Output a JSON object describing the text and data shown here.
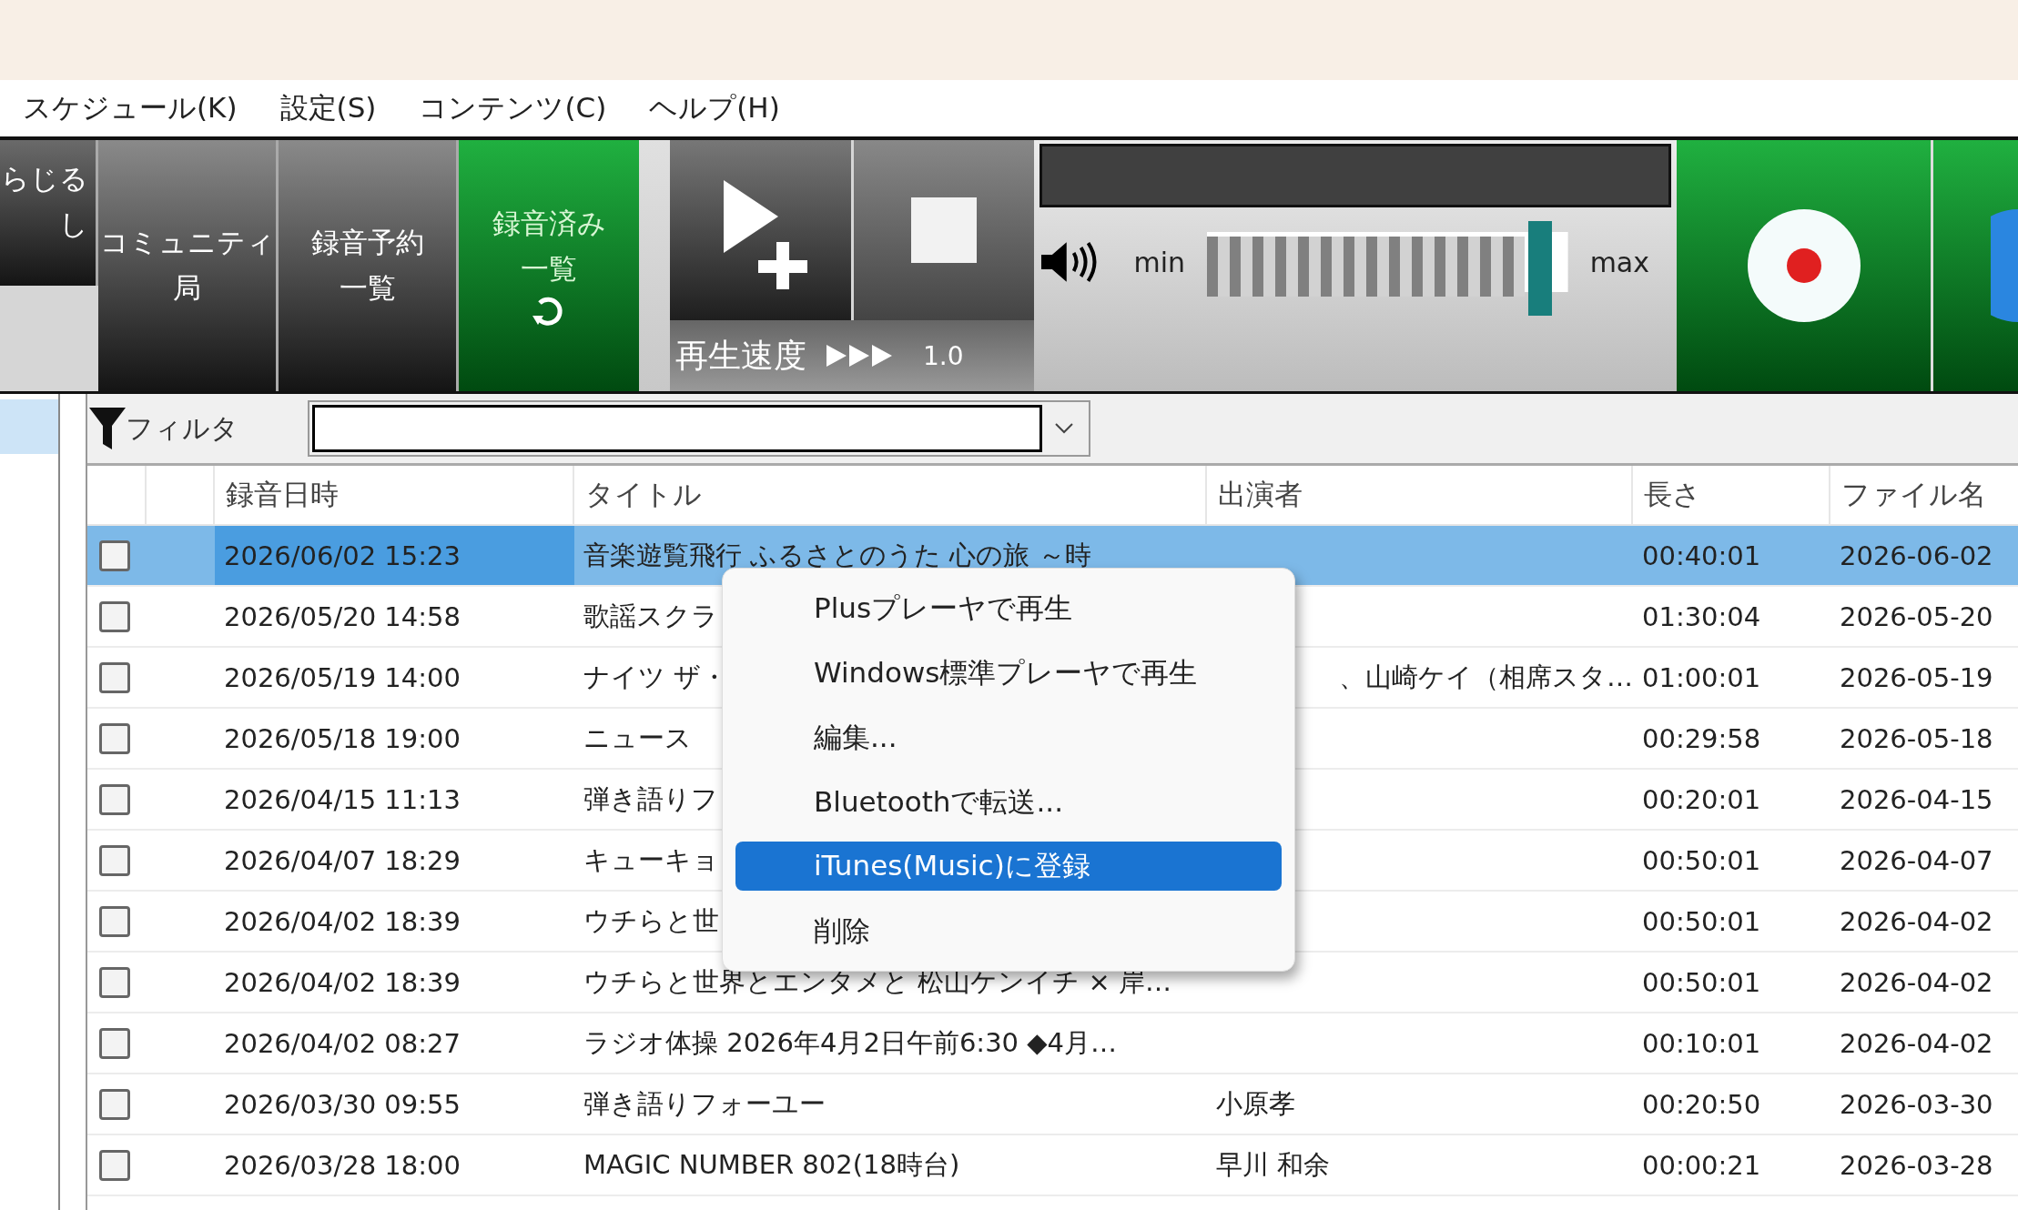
{
  "menu_bar": [
    {
      "label": "スケジュール(K)"
    },
    {
      "label": "設定(S)"
    },
    {
      "label": "コンテンツ(C)"
    },
    {
      "label": "ヘルプ(H)"
    }
  ],
  "toolbar": {
    "nav_buttons": [
      {
        "kind": "partial",
        "lines": [
          "らじる",
          "し"
        ],
        "selected": false,
        "refresh": false
      },
      {
        "kind": "full",
        "lines": [
          "コミュニティ",
          "局"
        ],
        "selected": false,
        "refresh": false
      },
      {
        "kind": "full",
        "lines": [
          "録音予約",
          "一覧"
        ],
        "selected": false,
        "refresh": false
      },
      {
        "kind": "full",
        "lines": [
          "録音済み",
          "一覧"
        ],
        "selected": true,
        "refresh": true
      }
    ],
    "speed": {
      "label": "再生速度",
      "value": "1.0"
    },
    "volume": {
      "min_label": "min",
      "max_label": "max",
      "level": 0.88
    }
  },
  "sidebar": {
    "items": [
      {
        "selected": true
      }
    ]
  },
  "filter": {
    "label": "フィルタ"
  },
  "table": {
    "columns": [
      "録音日時",
      "タイトル",
      "出演者",
      "長さ",
      "ファイル名"
    ],
    "rows": [
      {
        "checked": false,
        "selected": true,
        "date": "2026/06/02 15:23",
        "title": "音楽遊覧飛行 ふるさとのうた 心の旅 ～時",
        "length": "00:40:01",
        "file": "2026-06-02"
      },
      {
        "checked": false,
        "selected": false,
        "date": "2026/05/20 14:58",
        "title": "歌謡スクラ",
        "length": "01:30:04",
        "file": "2026-05-20"
      },
      {
        "checked": false,
        "selected": false,
        "date": "2026/05/19 14:00",
        "title": "ナイツ ザ・",
        "performer": {
          "text": "、山崎ケイ（相席スタ…",
          "cut": true
        },
        "length": "01:00:01",
        "file": "2026-05-19"
      },
      {
        "checked": false,
        "selected": false,
        "date": "2026/05/18 19:00",
        "title": "ニュース",
        "length": "00:29:58",
        "file": "2026-05-18"
      },
      {
        "checked": false,
        "selected": false,
        "date": "2026/04/15 11:13",
        "title": "弾き語りフ",
        "length": "00:20:01",
        "file": "2026-04-15"
      },
      {
        "checked": false,
        "selected": false,
        "date": "2026/04/07 18:29",
        "title": "キューキョ",
        "length": "00:50:01",
        "file": "2026-04-07"
      },
      {
        "checked": false,
        "selected": false,
        "date": "2026/04/02 18:39",
        "title": "ウチらと世",
        "length": "00:50:01",
        "file": "2026-04-02"
      },
      {
        "checked": false,
        "selected": false,
        "date": "2026/04/02 18:39",
        "title": "ウチらと世界とエンタメと 松山ケンイチ × 岸…",
        "length": "00:50:01",
        "file": "2026-04-02"
      },
      {
        "checked": false,
        "selected": false,
        "date": "2026/04/02 08:27",
        "title": "ラジオ体操 2026年4月2日午前6:30 ◆4月…",
        "length": "00:10:01",
        "file": "2026-04-02"
      },
      {
        "checked": false,
        "selected": false,
        "date": "2026/03/30 09:55",
        "title": "弾き語りフォーユー",
        "performer": {
          "text": "小原孝"
        },
        "length": "00:20:50",
        "file": "2026-03-30"
      },
      {
        "checked": false,
        "selected": false,
        "date": "2026/03/28 18:00",
        "title": "MAGIC NUMBER 802(18時台)",
        "performer": {
          "text": "早川 和余"
        },
        "length": "00:00:21",
        "file": "2026-03-28"
      }
    ]
  },
  "context_menu": {
    "items": [
      {
        "label": "Plusプレーヤで再生",
        "selected": false
      },
      {
        "label": "Windows標準プレーヤで再生",
        "selected": false
      },
      {
        "label": "編集...",
        "selected": false
      },
      {
        "label": "Bluetoothで転送...",
        "selected": false
      },
      {
        "label": "iTunes(Music)に登録",
        "selected": true
      },
      {
        "label": "削除",
        "selected": false
      }
    ]
  }
}
